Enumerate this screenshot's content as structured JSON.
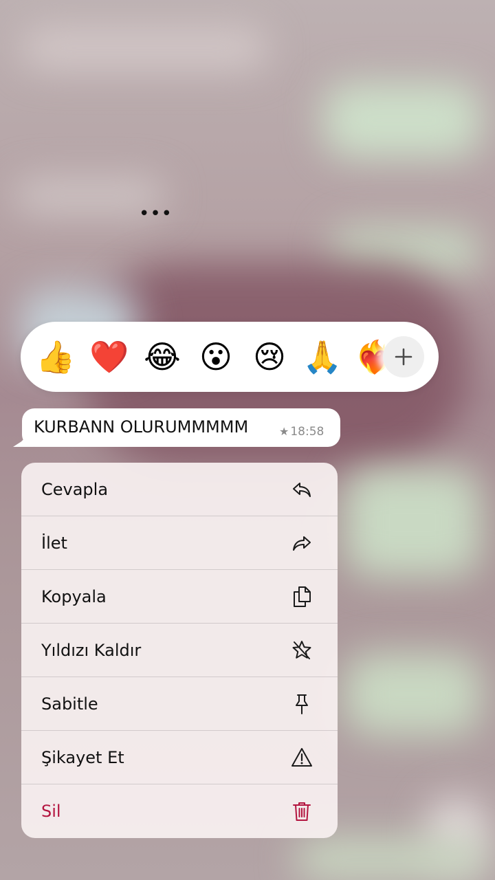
{
  "reactions": {
    "emojis": [
      "👍",
      "❤️",
      "😂",
      "😮",
      "😢",
      "🙏",
      "❤️‍🔥"
    ],
    "more_icon": "plus-icon"
  },
  "message": {
    "text": "KURBANN OLURUMMMMM",
    "time": "18:58",
    "starred": true,
    "more_indicator": "•••"
  },
  "menu": {
    "items": [
      {
        "label": "Cevapla",
        "icon": "reply-icon"
      },
      {
        "label": "İlet",
        "icon": "forward-icon"
      },
      {
        "label": "Kopyala",
        "icon": "copy-icon"
      },
      {
        "label": "Yıldızı Kaldır",
        "icon": "unstar-icon"
      },
      {
        "label": "Sabitle",
        "icon": "pin-icon"
      },
      {
        "label": "Şikayet Et",
        "icon": "warning-icon"
      },
      {
        "label": "Sil",
        "icon": "trash-icon"
      }
    ]
  },
  "colors": {
    "danger": "#b3143f",
    "menu_background": "#f7f0f0",
    "bubble": "#ffffff",
    "meta_text": "#8a8a8a"
  }
}
